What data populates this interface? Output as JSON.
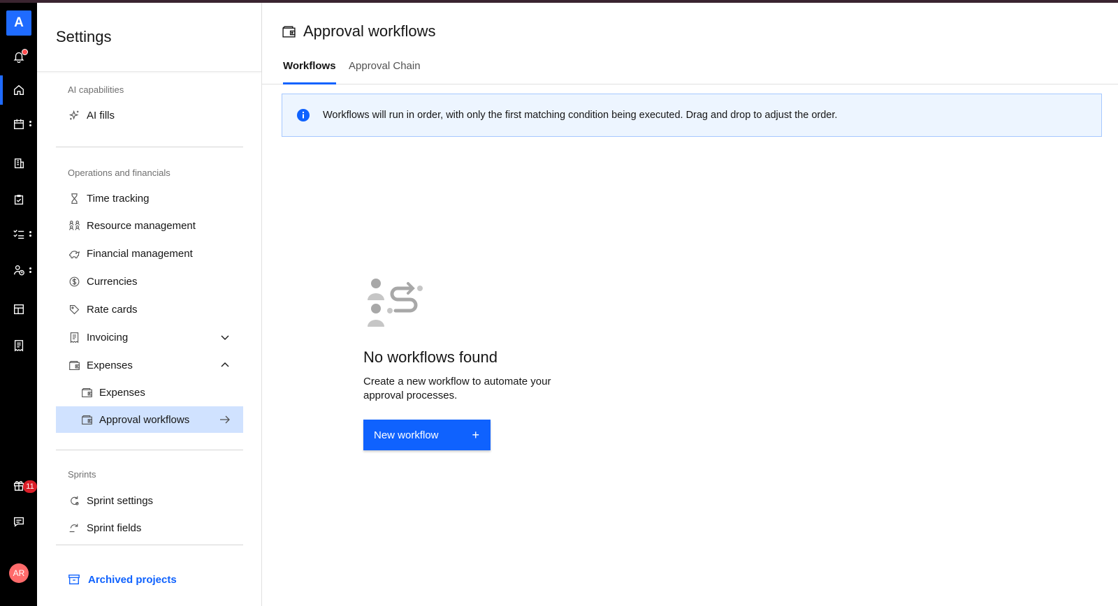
{
  "rail": {
    "logo_letter": "A",
    "gift_badge": "11",
    "avatar_initials": "AR",
    "accent_color": "#1f6bff"
  },
  "sidebar": {
    "title": "Settings",
    "sections": {
      "ai": {
        "label": "AI capabilities",
        "items": [
          {
            "label": "AI fills",
            "icon": "sparkle-icon"
          }
        ]
      },
      "ops": {
        "label": "Operations and financials",
        "items": [
          {
            "label": "Time tracking",
            "icon": "hourglass-icon"
          },
          {
            "label": "Resource management",
            "icon": "people-icon"
          },
          {
            "label": "Financial management",
            "icon": "piggy-bank-icon"
          },
          {
            "label": "Currencies",
            "icon": "currency-icon"
          },
          {
            "label": "Rate cards",
            "icon": "tag-icon"
          },
          {
            "label": "Invoicing",
            "icon": "receipt-icon"
          },
          {
            "label": "Expenses",
            "icon": "wallet-icon"
          },
          {
            "label": "Expenses",
            "icon": "wallet-icon"
          },
          {
            "label": "Approval workflows",
            "icon": "wallet-icon"
          }
        ]
      },
      "sprints": {
        "label": "Sprints",
        "items": [
          {
            "label": "Sprint settings",
            "icon": "sprint-settings-icon"
          },
          {
            "label": "Sprint fields",
            "icon": "sprint-fields-icon"
          }
        ]
      }
    },
    "archived_label": "Archived projects"
  },
  "main": {
    "title": "Approval workflows",
    "tabs": [
      {
        "label": "Workflows"
      },
      {
        "label": "Approval Chain"
      }
    ],
    "info_text": "Workflows will run in order, with only the first matching condition being executed. Drag and drop to adjust the order.",
    "empty": {
      "title": "No workflows found",
      "description": "Create a new workflow to automate your approval processes.",
      "button_label": "New workflow",
      "button_icon": "+"
    }
  }
}
